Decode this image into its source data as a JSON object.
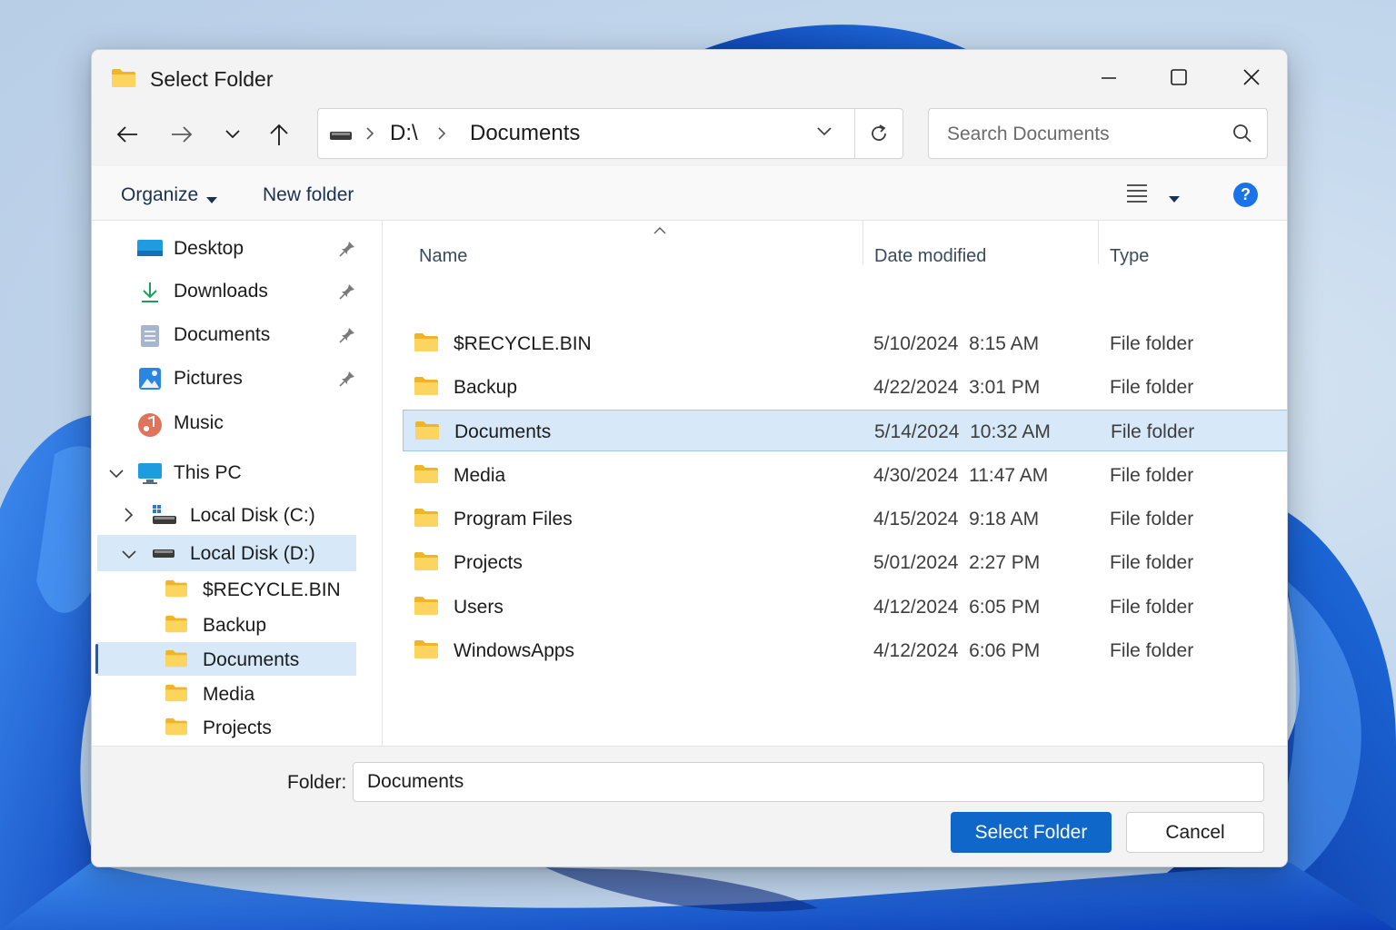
{
  "window": {
    "title": "Select Folder"
  },
  "address_bar": {
    "drive": "D:\\",
    "folder": "Documents"
  },
  "search": {
    "placeholder": "Search Documents"
  },
  "command_bar": {
    "organize": "Organize",
    "new_folder": "New folder",
    "help": "?"
  },
  "sidebar": {
    "quick_access": [
      {
        "label": "Desktop",
        "icon": "desktop-icon",
        "pinned": true
      },
      {
        "label": "Downloads",
        "icon": "download-icon",
        "pinned": true
      },
      {
        "label": "Documents",
        "icon": "documents-icon",
        "pinned": true
      },
      {
        "label": "Pictures",
        "icon": "pictures-icon",
        "pinned": true
      },
      {
        "label": "Music",
        "icon": "music-icon",
        "pinned": false
      }
    ],
    "this_pc": "This PC",
    "drives": [
      {
        "label": "Local Disk (C:)",
        "expanded": false
      },
      {
        "label": "Local Disk (D:)",
        "expanded": true
      }
    ],
    "d_children": [
      "$RECYCLE.BIN",
      "Backup",
      "Documents",
      "Media",
      "Projects"
    ],
    "selected_child": "Documents"
  },
  "file_list": {
    "columns": {
      "name": "Name",
      "date": "Date modified",
      "type": "Type"
    },
    "rows": [
      {
        "name": "$RECYCLE.BIN",
        "date": "5/10/2024  8:15 AM",
        "type": "File folder"
      },
      {
        "name": "Backup",
        "date": "4/22/2024  3:01 PM",
        "type": "File folder"
      },
      {
        "name": "Documents",
        "date": "5/14/2024  10:32 AM",
        "type": "File folder",
        "selected": true
      },
      {
        "name": "Media",
        "date": "4/30/2024  11:47 AM",
        "type": "File folder"
      },
      {
        "name": "Program Files",
        "date": "4/15/2024  9:18 AM",
        "type": "File folder"
      },
      {
        "name": "Projects",
        "date": "5/01/2024  2:27 PM",
        "type": "File folder"
      },
      {
        "name": "Users",
        "date": "4/12/2024  6:05 PM",
        "type": "File folder"
      },
      {
        "name": "WindowsApps",
        "date": "4/12/2024  6:06 PM",
        "type": "File folder"
      }
    ]
  },
  "footer": {
    "folder_label": "Folder:",
    "folder_value": "Documents",
    "select_button": "Select Folder",
    "cancel_button": "Cancel"
  },
  "colors": {
    "accent": "#0f67c9",
    "selection": "#d7e9f9",
    "folder": "#f7c948"
  }
}
